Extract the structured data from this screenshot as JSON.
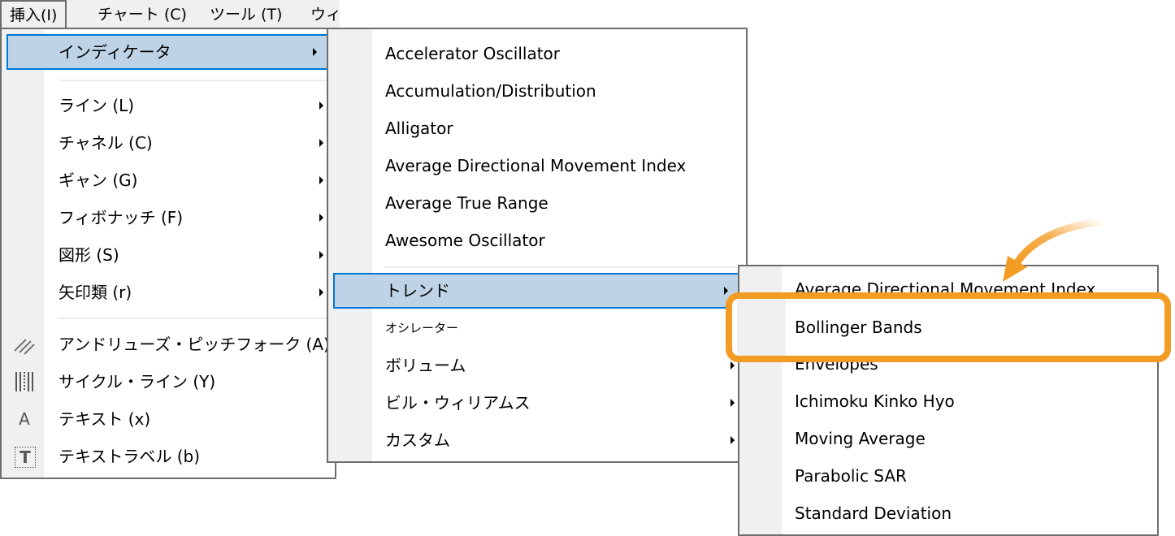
{
  "menubar": {
    "items": [
      {
        "label": "挿入(I)",
        "open": true
      },
      {
        "label": "チャート (C)"
      },
      {
        "label": "ツール (T)"
      },
      {
        "label": "ウィ"
      }
    ]
  },
  "insert_menu": {
    "items": [
      {
        "label": "インディケータ",
        "submenu": true,
        "highlighted": true
      },
      {
        "label": "ライン (L)",
        "submenu": true
      },
      {
        "label": "チャネル (C)",
        "submenu": true
      },
      {
        "label": "ギャン (G)",
        "submenu": true
      },
      {
        "label": "フィボナッチ (F)",
        "submenu": true
      },
      {
        "label": "図形 (S)",
        "submenu": true
      },
      {
        "label": "矢印類 (r)",
        "submenu": true
      },
      {
        "label": "アンドリューズ・ピッチフォーク (A)",
        "icon": "pitchfork-icon"
      },
      {
        "label": "サイクル・ライン (Y)",
        "icon": "cycle-lines-icon"
      },
      {
        "label": "テキスト (x)",
        "icon": "text-icon",
        "icon_glyph": "A"
      },
      {
        "label": "テキストラベル (b)",
        "icon": "text-label-icon",
        "icon_glyph": "T"
      }
    ]
  },
  "indicators_menu": {
    "items": [
      {
        "label": "Accelerator Oscillator"
      },
      {
        "label": "Accumulation/Distribution"
      },
      {
        "label": "Alligator"
      },
      {
        "label": "Average Directional Movement Index"
      },
      {
        "label": "Average True Range"
      },
      {
        "label": "Awesome Oscillator"
      },
      {
        "label": "トレンド",
        "submenu": true,
        "highlighted": true
      },
      {
        "label": "オシレーター",
        "submenu": true
      },
      {
        "label": "ボリューム",
        "submenu": true
      },
      {
        "label": "ビル・ウィリアムス",
        "submenu": true
      },
      {
        "label": "カスタム",
        "submenu": true
      }
    ]
  },
  "trend_menu": {
    "items": [
      {
        "label": "Average Directional Movement Index"
      },
      {
        "label": "Bollinger Bands",
        "emphasized": true
      },
      {
        "label": "Envelopes"
      },
      {
        "label": "Ichimoku Kinko Hyo"
      },
      {
        "label": "Moving Average"
      },
      {
        "label": "Parabolic SAR"
      },
      {
        "label": "Standard Deviation"
      }
    ]
  },
  "annotation": {
    "color": "#f39c24",
    "target": "Bollinger Bands"
  }
}
